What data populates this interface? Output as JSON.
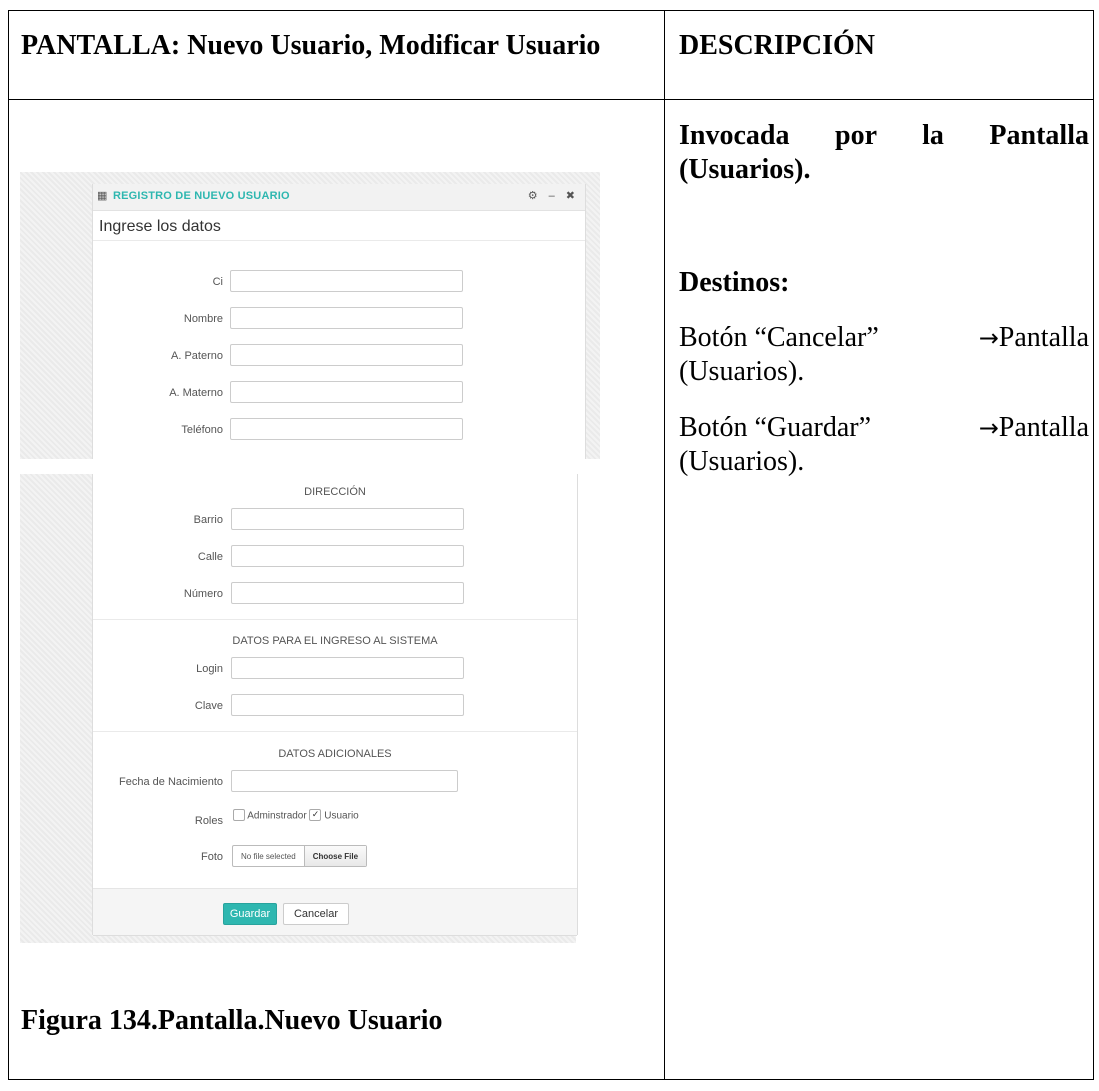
{
  "header": {
    "left": "PANTALLA: Nuevo Usuario, Modificar Usuario",
    "right": "DESCRIPCIÓN"
  },
  "description": {
    "invocation": "Invocada por la Pantalla (Usuarios).",
    "destinations_title": "Destinos:",
    "cancel_line": "Botón “Cancelar”",
    "save_line": "Botón “Guardar”",
    "arrow_target": "Pantalla (Usuarios).",
    "arrow_glyph": "→"
  },
  "caption": "Figura 134.Pantalla.Nuevo Usuario",
  "screenshot": {
    "panel_title": "REGISTRO DE NUEVO USUARIO",
    "panel_tools": "⚙ – ✖",
    "subtitle": "Ingrese los datos",
    "personal_fields": [
      "Ci",
      "Nombre",
      "A. Paterno",
      "A. Materno",
      "Teléfono"
    ],
    "address_title": "DIRECCIÓN",
    "address_fields": [
      "Barrio",
      "Calle",
      "Número"
    ],
    "login_title": "DATOS PARA EL INGRESO AL SISTEMA",
    "login_fields": [
      "Login",
      "Clave"
    ],
    "extra_title": "DATOS ADICIONALES",
    "birth_label": "Fecha de Nacimiento",
    "roles_label": "Roles",
    "role_admin": "Adminstrador",
    "role_user": "Usuario",
    "role_user_checked": true,
    "photo_label": "Foto",
    "file_status": "No file selected",
    "file_button": "Choose File",
    "save_button": "Guardar",
    "cancel_button": "Cancelar",
    "accent_color": "#2eb7b0"
  }
}
